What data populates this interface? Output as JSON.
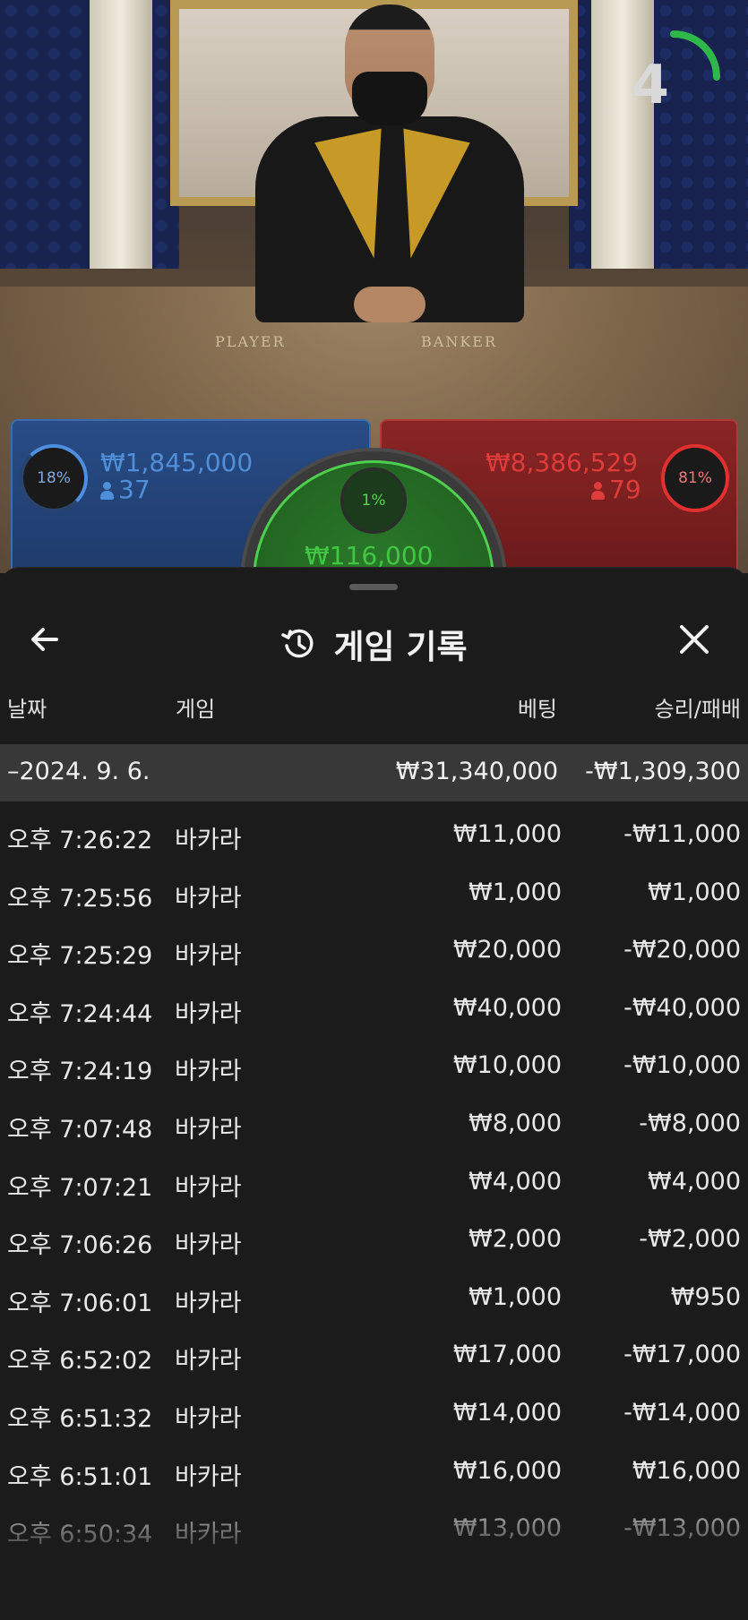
{
  "game_view": {
    "countdown": "4",
    "table_labels": {
      "player": "PLAYER",
      "banker": "BANKER"
    },
    "player": {
      "percent": "18%",
      "amount": "₩1,845,000",
      "players": "37"
    },
    "banker": {
      "percent": "81%",
      "amount": "₩8,386,529",
      "players": "79"
    },
    "tie": {
      "percent": "1%",
      "amount": "₩116,000"
    },
    "colors": {
      "player": "#4e8fd8",
      "banker": "#e03b3b",
      "tie": "#42c742",
      "timer": "#2fb84a"
    }
  },
  "sheet": {
    "title": "게임 기록",
    "icons": {
      "back": "arrow-left-icon",
      "history": "history-icon",
      "close": "close-icon"
    },
    "columns": {
      "date": "날짜",
      "game": "게임",
      "bet": "베팅",
      "result": "승리/패배"
    },
    "day_summary": {
      "date": "–2024. 9. 6.",
      "bet": "₩31,340,000",
      "result": "-₩1,309,300"
    },
    "rows": [
      {
        "time": "오후 7:26:22",
        "game": "바카라",
        "bet": "₩11,000",
        "result": "-₩11,000"
      },
      {
        "time": "오후 7:25:56",
        "game": "바카라",
        "bet": "₩1,000",
        "result": "₩1,000"
      },
      {
        "time": "오후 7:25:29",
        "game": "바카라",
        "bet": "₩20,000",
        "result": "-₩20,000"
      },
      {
        "time": "오후 7:24:44",
        "game": "바카라",
        "bet": "₩40,000",
        "result": "-₩40,000"
      },
      {
        "time": "오후 7:24:19",
        "game": "바카라",
        "bet": "₩10,000",
        "result": "-₩10,000"
      },
      {
        "time": "오후 7:07:48",
        "game": "바카라",
        "bet": "₩8,000",
        "result": "-₩8,000"
      },
      {
        "time": "오후 7:07:21",
        "game": "바카라",
        "bet": "₩4,000",
        "result": "₩4,000"
      },
      {
        "time": "오후 7:06:26",
        "game": "바카라",
        "bet": "₩2,000",
        "result": "-₩2,000"
      },
      {
        "time": "오후 7:06:01",
        "game": "바카라",
        "bet": "₩1,000",
        "result": "₩950"
      },
      {
        "time": "오후 6:52:02",
        "game": "바카라",
        "bet": "₩17,000",
        "result": "-₩17,000"
      },
      {
        "time": "오후 6:51:32",
        "game": "바카라",
        "bet": "₩14,000",
        "result": "-₩14,000"
      },
      {
        "time": "오후 6:51:01",
        "game": "바카라",
        "bet": "₩16,000",
        "result": "₩16,000"
      },
      {
        "time": "오후 6:50:34",
        "game": "바카라",
        "bet": "₩13,000",
        "result": "-₩13,000"
      }
    ]
  }
}
